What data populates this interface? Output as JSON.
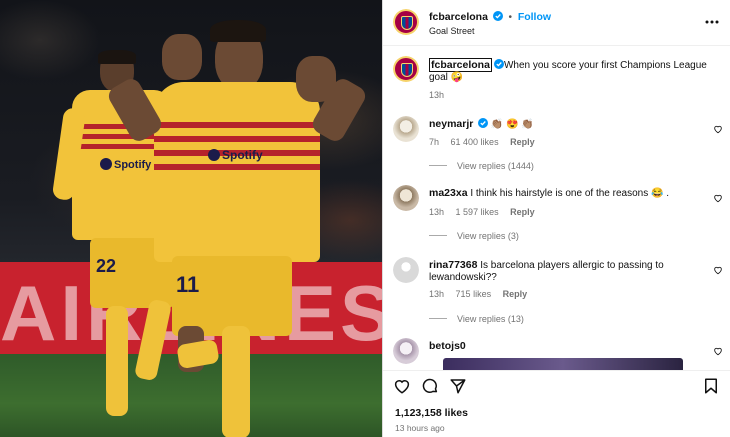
{
  "post": {
    "author": "fcbarcelona",
    "follow_label": "Follow",
    "location": "Goal Street",
    "caption_author": "fcbarcelona",
    "caption_text": "When you score your first Champions League goal 🤪",
    "caption_time": "13h",
    "likes": "1,123,158 likes",
    "posted_ago": "13 hours ago"
  },
  "media": {
    "board_text": "AIRLINES",
    "player_front": {
      "sponsor": "Spotify",
      "number": "11"
    },
    "player_back": {
      "sponsor": "Spotify",
      "number": "22"
    }
  },
  "comments": [
    {
      "username": "neymarjr",
      "verified": true,
      "text": "👏🏽 😍 👏🏽",
      "time": "7h",
      "likes": "61 400 likes",
      "reply": "Reply",
      "view_replies": "View replies (1444)",
      "avatar_color": "#e9e2d4"
    },
    {
      "username": "ma23xa",
      "verified": false,
      "text": "I think his hairstyle is one of the reasons 😂 .",
      "time": "13h",
      "likes": "1 597 likes",
      "reply": "Reply",
      "view_replies": "View replies (3)",
      "avatar_color": "#c9b9a6"
    },
    {
      "username": "rina77368",
      "verified": false,
      "text": "Is barcelona players allergic to passing to lewandowski??",
      "time": "13h",
      "likes": "715 likes",
      "reply": "Reply",
      "view_replies": "View replies (13)",
      "avatar_color": "#d9d9d9"
    },
    {
      "username": "betojs0",
      "verified": false,
      "text": "",
      "avatar_color": "#d7ccd8"
    }
  ],
  "colors": {
    "link_blue": "#0095f6",
    "verified_blue": "#0095f6",
    "muted": "#737373",
    "barca_red": "#a50044",
    "kit_yellow": "#f2c33a"
  },
  "icons": [
    "more-icon",
    "heart-icon",
    "comment-icon",
    "share-icon",
    "bookmark-icon",
    "verified-icon"
  ]
}
